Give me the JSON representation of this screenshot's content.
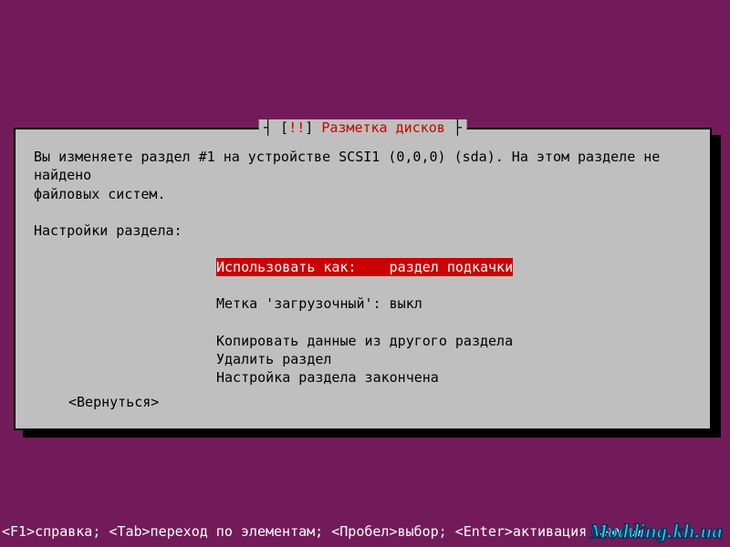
{
  "dialog": {
    "title_bracket_open": "┤ [",
    "title_excl": "!!",
    "title_bracket_mid": "] ",
    "title_text": "Разметка дисков",
    "title_bracket_close": " ├",
    "body_line1": "Вы изменяете раздел #1 на устройстве SCSI1 (0,0,0) (sda). На этом разделе не найдено",
    "body_line2": "файловых систем.",
    "settings_heading": "Настройки раздела:",
    "options": {
      "use_as_label": "Использовать как:    ",
      "use_as_value": "раздел подкачки",
      "bootable_label": "Метка 'загрузочный': ",
      "bootable_value": "выкл",
      "copy_data": "Копировать данные из другого раздела",
      "delete_partition": "Удалить раздел",
      "done": "Настройка раздела закончена"
    },
    "back_button": "<Вернуться>"
  },
  "bottom_bar": "<F1>справка; <Tab>переход по элементам; <Пробел>выбор; <Enter>активация кнопок",
  "watermark": "Modding.kh.ua"
}
